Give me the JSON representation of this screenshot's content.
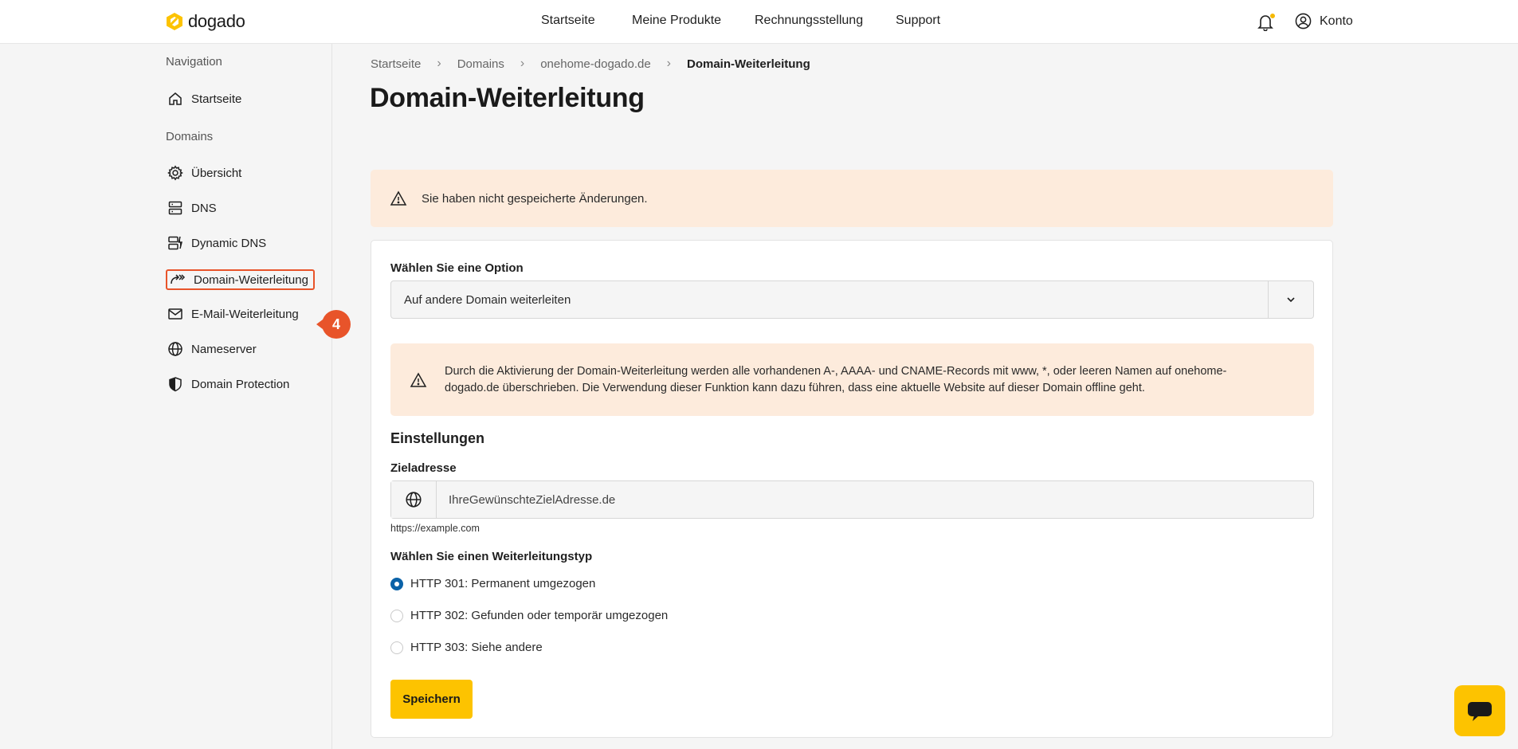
{
  "brand": {
    "name": "dogado",
    "accent": "#fdc300"
  },
  "topnav": {
    "items": [
      "Startseite",
      "Meine Produkte",
      "Rechnungsstellung",
      "Support"
    ],
    "notifications_icon": "bell-icon",
    "account_label": "Konto"
  },
  "sidebar": {
    "heading_navigation": "Navigation",
    "home_label": "Startseite",
    "heading_domains": "Domains",
    "items": [
      {
        "label": "Übersicht",
        "icon": "gear-icon"
      },
      {
        "label": "DNS",
        "icon": "server-icon"
      },
      {
        "label": "Dynamic DNS",
        "icon": "dynamic-dns-icon"
      },
      {
        "label": "Domain-Weiterleitung",
        "icon": "forward-icon",
        "active": true
      },
      {
        "label": "E-Mail-Weiterleitung",
        "icon": "mail-icon"
      },
      {
        "label": "Nameserver",
        "icon": "globe-icon"
      },
      {
        "label": "Domain Protection",
        "icon": "shield-icon"
      }
    ],
    "step_badge": "4"
  },
  "breadcrumb": [
    "Startseite",
    "Domains",
    "onehome-dogado.de",
    "Domain-Weiterleitung"
  ],
  "page_title": "Domain-Weiterleitung",
  "unsaved_alert": "Sie haben nicht gespeicherte Änderungen.",
  "form": {
    "option_label": "Wählen Sie eine Option",
    "option_value": "Auf andere Domain weiterleiten",
    "warning_text": "Durch die Aktivierung der Domain-Weiterleitung werden alle vorhandenen A-, AAAA- und CNAME-Records mit www, *, oder leeren Namen auf onehome-dogado.de überschrieben. Die Verwendung dieser Funktion kann dazu führen, dass eine aktuelle Website auf dieser Domain offline geht.",
    "settings_title": "Einstellungen",
    "target_label": "Zieladresse",
    "target_placeholder": "IhreGewünschteZielAdresse.de",
    "target_hint": "https://example.com",
    "redirect_type_label": "Wählen Sie einen Weiterleitungstyp",
    "redirect_types": [
      {
        "label": "HTTP 301: Permanent umgezogen",
        "checked": true
      },
      {
        "label": "HTTP 302: Gefunden oder temporär umgezogen",
        "checked": false
      },
      {
        "label": "HTTP 303: Siehe andere",
        "checked": false
      }
    ],
    "save_label": "Speichern"
  }
}
